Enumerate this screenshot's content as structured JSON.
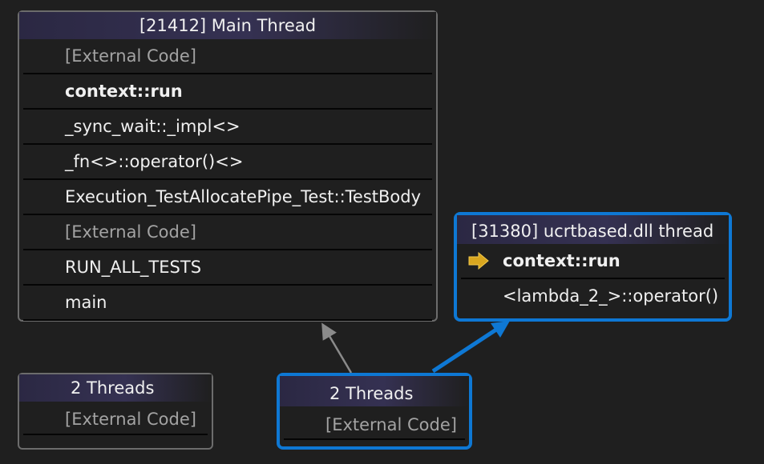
{
  "main_thread": {
    "title": "[21412] Main Thread",
    "frames": [
      {
        "label": "[External Code]"
      },
      {
        "label": "context::run"
      },
      {
        "label": "_sync_wait::_impl<>"
      },
      {
        "label": "_fn<>::operator()<>"
      },
      {
        "label": "Execution_TestAllocatePipe_Test::TestBody"
      },
      {
        "label": "[External Code]"
      },
      {
        "label": "RUN_ALL_TESTS"
      },
      {
        "label": "main"
      }
    ]
  },
  "ucrt_thread": {
    "title": "[31380] ucrtbased.dll thread",
    "frames": [
      {
        "label": "context::run",
        "icon": "current-frame-arrow-icon"
      },
      {
        "label": "<lambda_2_>::operator()"
      }
    ]
  },
  "threads_left": {
    "title": "2 Threads",
    "frames": [
      {
        "label": "[External Code]"
      }
    ]
  },
  "threads_right": {
    "title": "2 Threads",
    "frames": [
      {
        "label": "[External Code]"
      }
    ]
  },
  "colors": {
    "selected_border": "#0e78d4",
    "node_border": "#6c6c6c",
    "background": "#1f1f1f",
    "header": "#2f2c4a",
    "current_arrow": "#d9a61f"
  }
}
